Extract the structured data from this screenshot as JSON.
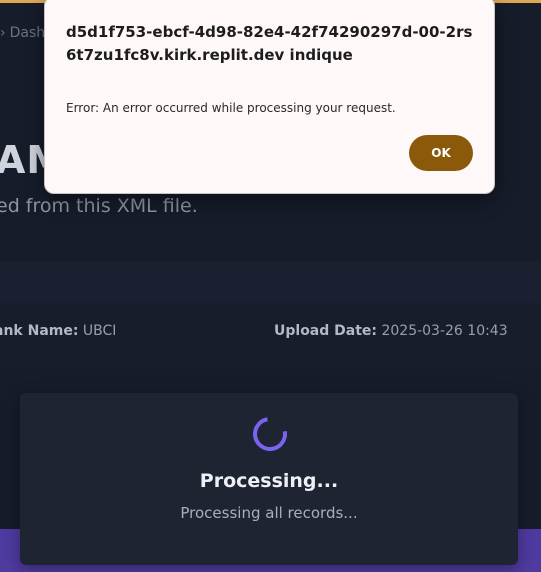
{
  "breadcrumb": {
    "label": "Dash"
  },
  "page": {
    "title_partial": "AM",
    "subtitle": "ed from this XML file."
  },
  "info": {
    "bank_label": "ank Name:",
    "bank_value": "UBCI",
    "upload_label": "Upload Date:",
    "upload_value": "2025-03-26 10:43"
  },
  "processing": {
    "title": "Processing...",
    "subtitle": "Processing all records..."
  },
  "alert": {
    "title": "d5d1f753-ebcf-4d98-82e4-42f74290297d-00-2rs6t7zu1fc8v.kirk.replit.dev indique",
    "message": "Error: An error occurred while processing your request.",
    "ok_label": "OK"
  },
  "colors": {
    "accent_purple": "#7b63f0",
    "ok_button": "#8a5a0a",
    "top_strip": "#e0a752",
    "footer_band": "#4f3aa0"
  }
}
